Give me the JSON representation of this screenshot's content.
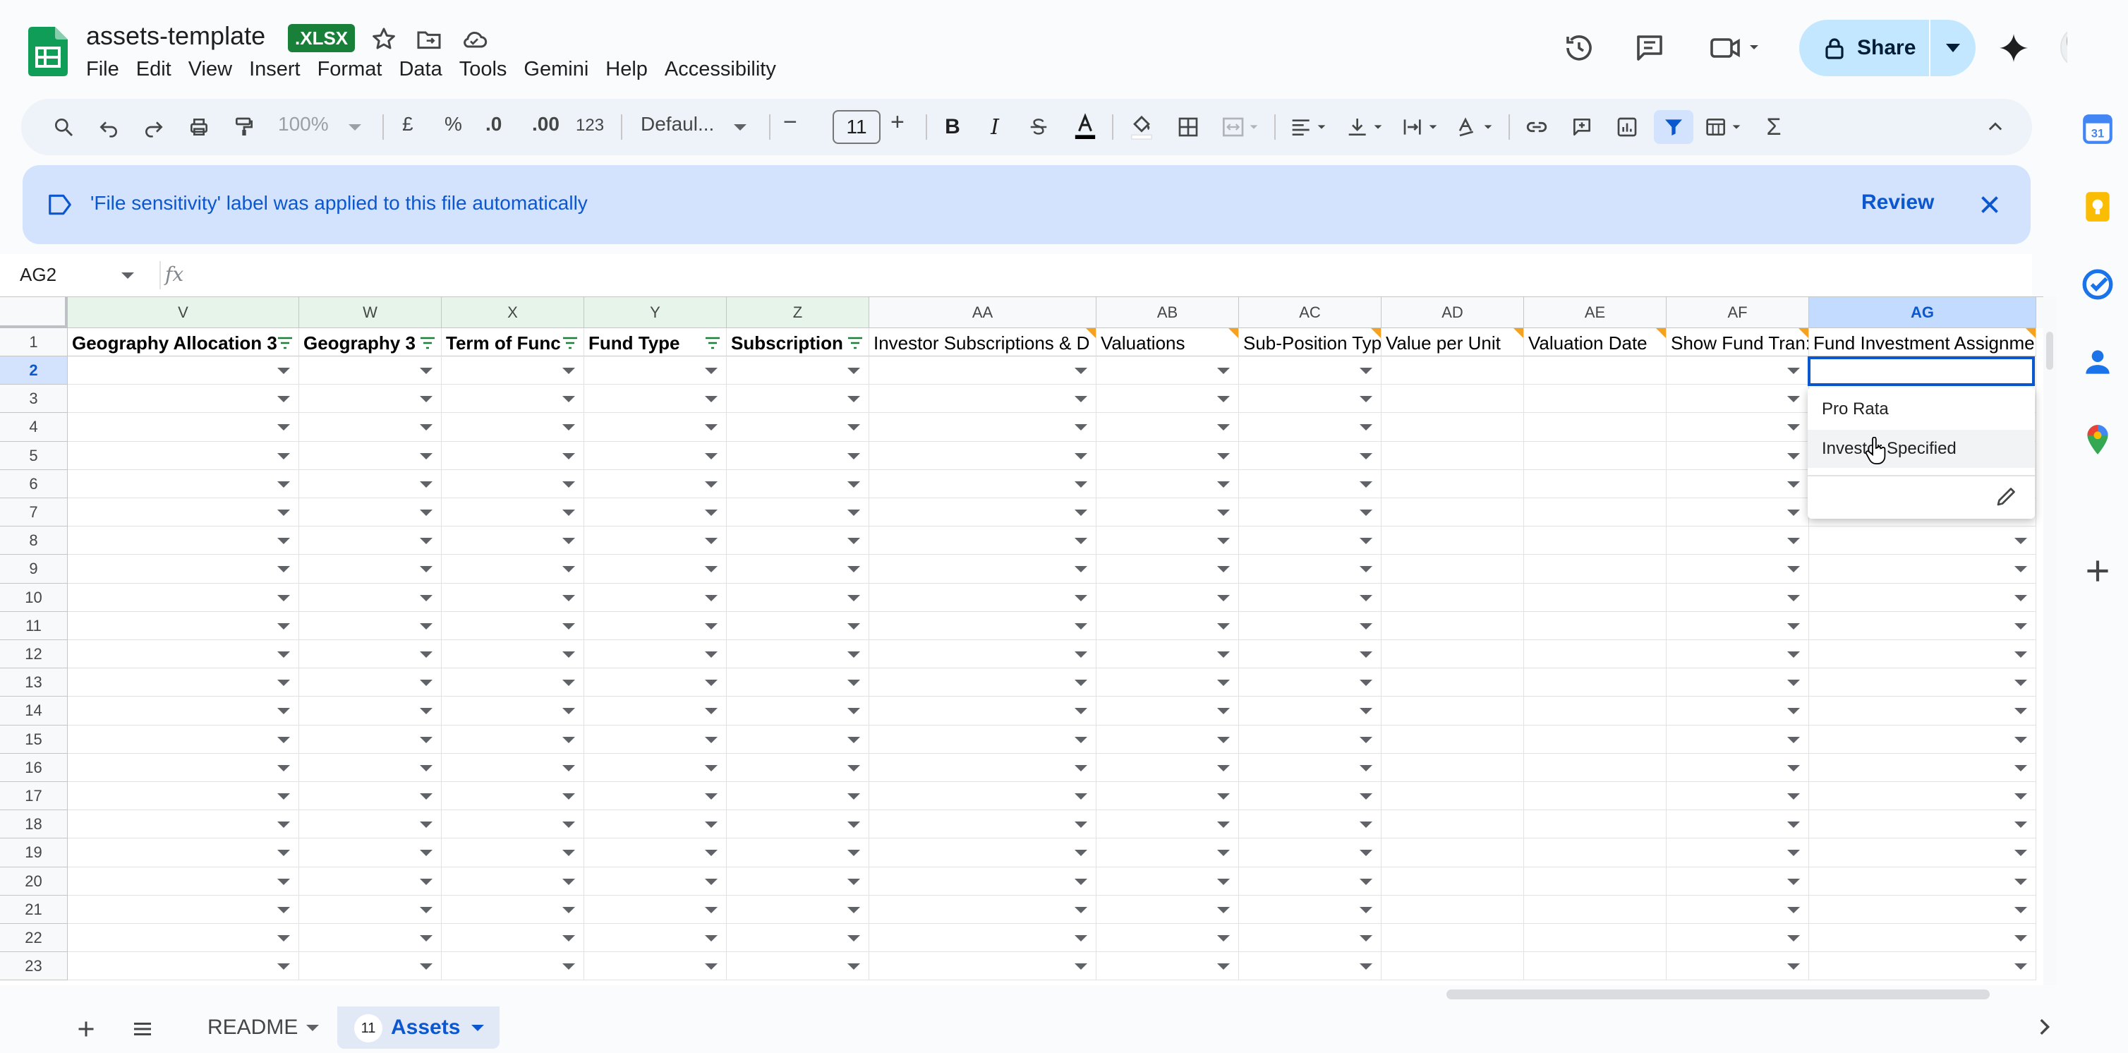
{
  "doc": {
    "title": "assets-template",
    "format_badge": ".XLSX"
  },
  "menu": [
    "File",
    "Edit",
    "View",
    "Insert",
    "Format",
    "Data",
    "Tools",
    "Gemini",
    "Help",
    "Accessibility"
  ],
  "share": {
    "label": "Share"
  },
  "toolbar": {
    "zoom": "100%",
    "currency": "£",
    "percent": "%",
    "dec_decrease": ".0",
    "dec_increase": ".00",
    "number_format": "123",
    "font": "Defaul...",
    "font_size": "11",
    "minus": "−",
    "plus": "+"
  },
  "banner": {
    "message": "'File sensitivity' label was applied to this file automatically",
    "review": "Review"
  },
  "formula_bar": {
    "cell_ref": "AG2",
    "fx": "fx",
    "value": ""
  },
  "grid": {
    "columns": [
      {
        "letter": "V",
        "header": "Geography Allocation 3",
        "bold": true,
        "filter": true,
        "note": false
      },
      {
        "letter": "W",
        "header": "Geography 3",
        "bold": true,
        "filter": true,
        "note": false
      },
      {
        "letter": "X",
        "header": "Term of Func",
        "bold": true,
        "filter": true,
        "note": false
      },
      {
        "letter": "Y",
        "header": "Fund Type",
        "bold": true,
        "filter": true,
        "note": false
      },
      {
        "letter": "Z",
        "header": "Subscription",
        "bold": true,
        "filter": true,
        "note": false
      },
      {
        "letter": "AA",
        "header": "Investor Subscriptions & D",
        "bold": false,
        "filter": false,
        "note": true
      },
      {
        "letter": "AB",
        "header": "Valuations",
        "bold": false,
        "filter": false,
        "note": true
      },
      {
        "letter": "AC",
        "header": "Sub-Position Typ",
        "bold": false,
        "filter": false,
        "note": true
      },
      {
        "letter": "AD",
        "header": "Value per Unit",
        "bold": false,
        "filter": false,
        "note": true
      },
      {
        "letter": "AE",
        "header": "Valuation Date",
        "bold": false,
        "filter": false,
        "note": true
      },
      {
        "letter": "AF",
        "header": "Show Fund Tran:",
        "bold": false,
        "filter": false,
        "note": true
      },
      {
        "letter": "AG",
        "header": "Fund Investment Assignme",
        "bold": false,
        "filter": false,
        "note": true
      }
    ],
    "rows": [
      "1",
      "2",
      "3",
      "4",
      "5",
      "6",
      "7",
      "8",
      "9",
      "10",
      "11",
      "12",
      "13",
      "14",
      "15",
      "16",
      "17",
      "18",
      "19",
      "20",
      "21",
      "22",
      "23"
    ],
    "active_cell": "AG2"
  },
  "dropdown": {
    "options": [
      "Pro Rata",
      "Investor Specified"
    ],
    "hovered": "Investor Specified"
  },
  "sheets": [
    {
      "name": "README",
      "active": false
    },
    {
      "name": "Assets",
      "active": true,
      "count": "11"
    }
  ],
  "colors": {
    "accent": "#0b57d0",
    "share_bg": "#c2e7ff",
    "banner_bg": "#d3e3fd",
    "badge_green": "#188038",
    "note_triangle": "#f6a21e"
  },
  "icons": {
    "side_panel": [
      "calendar-icon",
      "keep-icon",
      "tasks-icon",
      "contacts-icon",
      "maps-icon",
      "add-icon"
    ]
  }
}
